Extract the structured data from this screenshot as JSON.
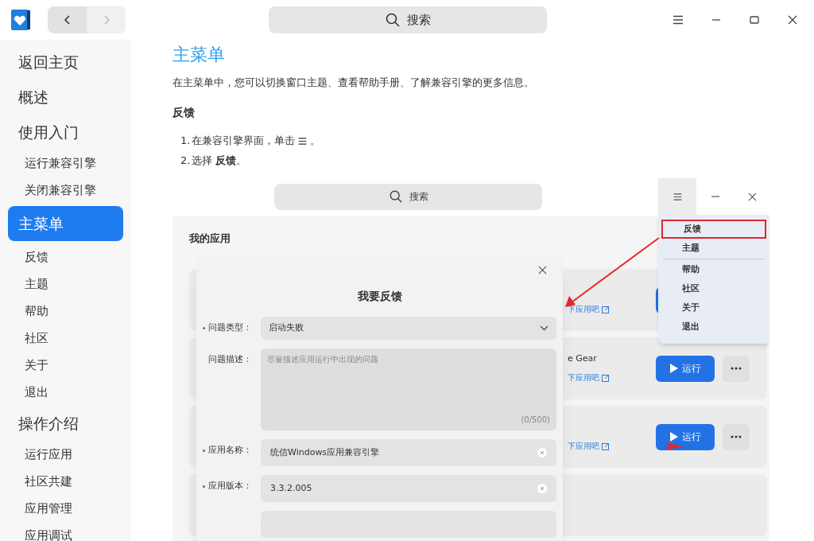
{
  "titlebar": {
    "search": {
      "placeholder": "搜索"
    },
    "back": {
      "disabled": false
    },
    "forward": {
      "disabled": true
    }
  },
  "sidebar": {
    "items": [
      {
        "kind": "section",
        "label": "返回主页",
        "selected": false
      },
      {
        "kind": "section",
        "label": "概述",
        "selected": false
      },
      {
        "kind": "section",
        "label": "使用入门",
        "selected": false
      },
      {
        "kind": "item",
        "label": "运行兼容引擎",
        "selected": false
      },
      {
        "kind": "item",
        "label": "关闭兼容引擎",
        "selected": false
      },
      {
        "kind": "section",
        "label": "主菜单",
        "selected": true
      },
      {
        "kind": "item",
        "label": "反馈",
        "selected": false
      },
      {
        "kind": "item",
        "label": "主题",
        "selected": false
      },
      {
        "kind": "item",
        "label": "帮助",
        "selected": false
      },
      {
        "kind": "item",
        "label": "社区",
        "selected": false
      },
      {
        "kind": "item",
        "label": "关于",
        "selected": false
      },
      {
        "kind": "item",
        "label": "退出",
        "selected": false
      },
      {
        "kind": "section",
        "label": "操作介绍",
        "selected": false
      },
      {
        "kind": "item",
        "label": "运行应用",
        "selected": false
      },
      {
        "kind": "item",
        "label": "社区共建",
        "selected": false
      },
      {
        "kind": "item",
        "label": "应用管理",
        "selected": false
      },
      {
        "kind": "item",
        "label": "应用调试",
        "selected": false
      }
    ]
  },
  "article": {
    "title": "主菜单",
    "intro": "在主菜单中，您可以切换窗口主题、查看帮助手册、了解兼容引擎的更多信息。",
    "subtitle": "反馈",
    "steps": [
      {
        "kind": "with_icon",
        "number": "1.",
        "before": "在兼容引擎界面，单击",
        "after": "。"
      },
      {
        "kind": "text",
        "number": "2.",
        "before": "选择 **反馈**。"
      }
    ]
  },
  "screenshot": {
    "search": {
      "placeholder": "搜索"
    },
    "heading": "我的应用",
    "rows": [
      {
        "link": "下应用吧"
      },
      {
        "name": "e Gear",
        "link": "下应用吧",
        "run": "运行"
      },
      {
        "link": "下应用吧",
        "run": "运行"
      }
    ],
    "menu": {
      "items": [
        {
          "label": "反馈",
          "highlighted": true
        },
        {
          "label": "主题",
          "highlighted": false
        },
        {
          "label": "帮助",
          "highlighted": false
        },
        {
          "label": "社区",
          "highlighted": false
        },
        {
          "label": "关于",
          "highlighted": false
        },
        {
          "label": "退出",
          "highlighted": false
        }
      ]
    },
    "dialog": {
      "title": "我要反馈",
      "fields": [
        {
          "kind": "select",
          "label": "问题类型：",
          "required": true,
          "value": "启动失败"
        },
        {
          "kind": "textarea",
          "label": "问题描述：",
          "required": false,
          "placeholder": "尽量描述应用运行中出现的问题",
          "counter": "(0/500)"
        },
        {
          "kind": "text",
          "label": "应用名称：",
          "required": true,
          "value": "统信Windows应用兼容引擎"
        },
        {
          "kind": "text",
          "label": "应用版本：",
          "required": true,
          "value": "3.3.2.005"
        },
        {
          "kind": "text",
          "required": false
        }
      ]
    }
  }
}
